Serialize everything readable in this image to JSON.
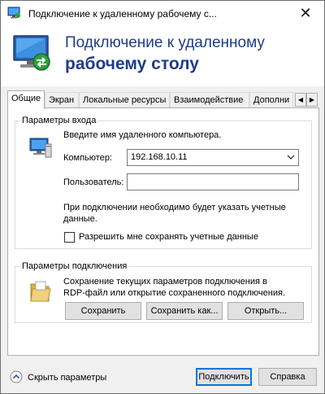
{
  "window": {
    "title": "Подключение к удаленному рабочему с...",
    "close_glyph": "✕"
  },
  "banner": {
    "line1": "Подключение к удаленному",
    "line2": "рабочему столу"
  },
  "tabs": [
    {
      "label": "Общие",
      "active": true
    },
    {
      "label": "Экран",
      "active": false
    },
    {
      "label": "Локальные ресурсы",
      "active": false
    },
    {
      "label": "Взаимодействие",
      "active": false
    },
    {
      "label": "Дополни",
      "active": false
    }
  ],
  "tab_scroll": {
    "left": "◀",
    "right": "▶"
  },
  "login_group": {
    "title": "Параметры входа",
    "prompt": "Введите имя удаленного компьютера.",
    "computer_label": "Компьютер:",
    "computer_value": "192.168.10.11",
    "user_label": "Пользователь:",
    "user_value": "",
    "info": "При подключении необходимо будет указать учетные",
    "info2": "данные.",
    "save_credentials_label": "Разрешить мне сохранять учетные данные",
    "save_credentials_checked": false
  },
  "connection_group": {
    "title": "Параметры подключения",
    "desc1": "Сохранение текущих параметров подключения в",
    "desc2": "RDP-файл или открытие сохраненного подключения.",
    "save_button": "Сохранить",
    "save_as_button": "Сохранить как...",
    "open_button": "Открыть..."
  },
  "footer": {
    "hide_options_label": "Скрыть параметры",
    "connect_button": "Подключить",
    "help_button": "Справка"
  },
  "colors": {
    "title_blue": "#1f3c88",
    "accent": "#0078d7"
  },
  "icons": [
    "remote-desktop-icon",
    "close-icon",
    "computer-icon",
    "folder-icon",
    "collapse-up-icon",
    "dropdown-arrow-icon"
  ]
}
